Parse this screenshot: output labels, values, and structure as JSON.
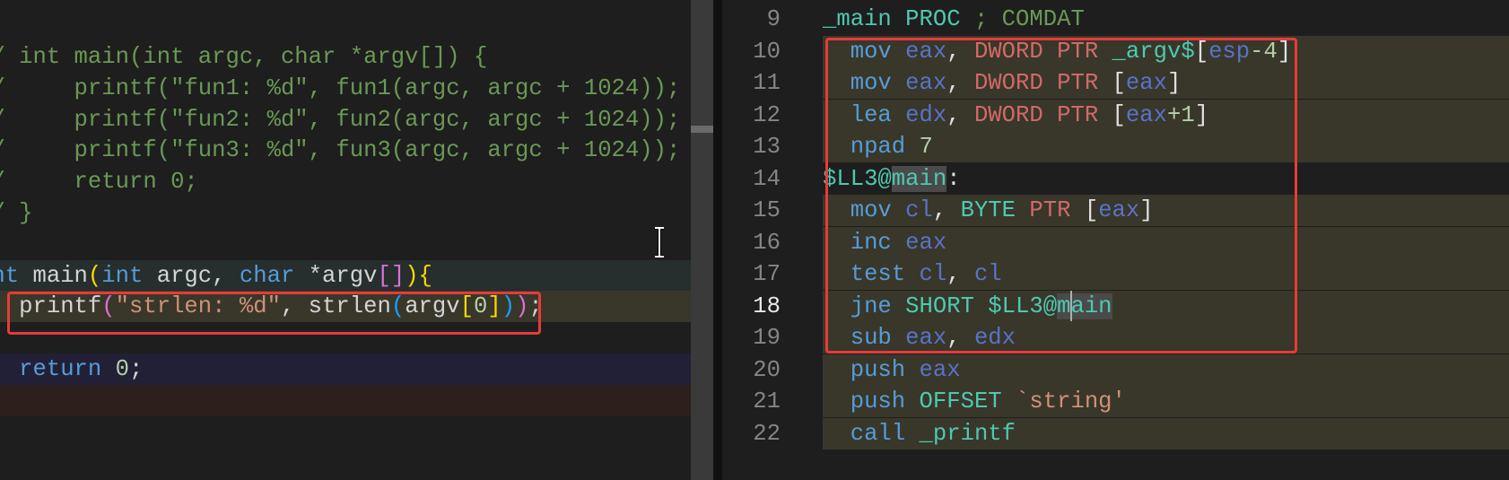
{
  "colors": {
    "highlight_box": "#e83a3a",
    "editor_bg": "#1e1e1e",
    "selection_bg": "#38372a"
  },
  "left_editor": {
    "lines": [
      {
        "bg": "",
        "tokens": [
          [
            "/ int main(int argc, char *argv[]) {",
            "comment"
          ]
        ]
      },
      {
        "bg": "",
        "tokens": [
          [
            "/     printf(\"fun1: %d\", fun1(argc, argc + 1024));",
            "comment"
          ]
        ]
      },
      {
        "bg": "",
        "tokens": [
          [
            "/     printf(\"fun2: %d\", fun2(argc, argc + 1024));",
            "comment"
          ]
        ]
      },
      {
        "bg": "",
        "tokens": [
          [
            "/     printf(\"fun3: %d\", fun3(argc, argc + 1024));",
            "comment"
          ]
        ]
      },
      {
        "bg": "",
        "tokens": [
          [
            "/     return 0;",
            "comment"
          ]
        ]
      },
      {
        "bg": "",
        "tokens": [
          [
            "/ }",
            "comment"
          ]
        ]
      },
      {
        "bg": "",
        "tokens": []
      },
      {
        "bg": "#262e2e",
        "tokens": [
          [
            "nt",
            "kw"
          ],
          [
            " main",
            "plain"
          ],
          [
            "(",
            "b-yellow"
          ],
          [
            "int",
            "kw"
          ],
          [
            " argc, ",
            "plain"
          ],
          [
            "char",
            "kw"
          ],
          [
            " *argv",
            "plain"
          ],
          [
            "[]",
            "b-pink"
          ],
          [
            ")",
            "b-yellow"
          ],
          [
            "{",
            "b-yellow"
          ]
        ]
      },
      {
        "bg": "#38372a",
        "tokens": [
          [
            "  printf",
            "plain"
          ],
          [
            "(",
            "b-pink"
          ],
          [
            "\"strlen: %d\"",
            "str"
          ],
          [
            ", strlen",
            "plain"
          ],
          [
            "(",
            "b-blue"
          ],
          [
            "argv",
            "plain"
          ],
          [
            "[",
            "b-yellow"
          ],
          [
            "0",
            "num"
          ],
          [
            "]",
            "b-yellow"
          ],
          [
            ")",
            "b-blue"
          ],
          [
            ")",
            "b-pink"
          ],
          [
            ";",
            "plain"
          ]
        ]
      },
      {
        "bg": "",
        "tokens": []
      },
      {
        "bg": "#222036",
        "tokens": [
          [
            "  return",
            "kw"
          ],
          [
            " ",
            "plain"
          ],
          [
            "0",
            "num"
          ],
          [
            ";",
            "plain"
          ]
        ]
      },
      {
        "bg": "#2d1f1c",
        "tokens": []
      },
      {
        "bg": "",
        "tokens": []
      }
    ]
  },
  "right_editor": {
    "active_line": "18",
    "lines": [
      {
        "num": "9",
        "bg": "",
        "tokens": [
          [
            "_main PROC",
            "sym"
          ],
          [
            " ; COMDAT",
            "comment"
          ]
        ]
      },
      {
        "num": "10",
        "bg": "#38372a",
        "tokens": [
          [
            "  mov",
            "op"
          ],
          [
            " eax",
            "reg"
          ],
          [
            ", ",
            "white"
          ],
          [
            "DWORD PTR",
            "ptr"
          ],
          [
            " _argv$",
            "sym"
          ],
          [
            "[",
            "white"
          ],
          [
            "esp",
            "reg"
          ],
          [
            "-4",
            "num"
          ],
          [
            "]",
            "white"
          ]
        ]
      },
      {
        "num": "11",
        "bg": "#38372a",
        "tokens": [
          [
            "  mov",
            "op"
          ],
          [
            " eax",
            "reg"
          ],
          [
            ", ",
            "white"
          ],
          [
            "DWORD PTR",
            "ptr"
          ],
          [
            " [",
            "white"
          ],
          [
            "eax",
            "reg"
          ],
          [
            "]",
            "white"
          ]
        ]
      },
      {
        "num": "12",
        "bg": "#38372a",
        "tokens": [
          [
            "  lea",
            "op"
          ],
          [
            " edx",
            "reg"
          ],
          [
            ", ",
            "white"
          ],
          [
            "DWORD PTR",
            "ptr"
          ],
          [
            " [",
            "white"
          ],
          [
            "eax",
            "reg"
          ],
          [
            "+1",
            "num"
          ],
          [
            "]",
            "white"
          ]
        ]
      },
      {
        "num": "13",
        "bg": "#38372a",
        "tokens": [
          [
            "  npad",
            "op"
          ],
          [
            " 7",
            "num"
          ]
        ]
      },
      {
        "num": "14",
        "bg": "",
        "tokens": [
          [
            "$LL3@",
            "sym"
          ],
          [
            "main",
            "sym hl"
          ],
          [
            ":",
            "white"
          ]
        ]
      },
      {
        "num": "15",
        "bg": "#38372a",
        "tokens": [
          [
            "  mov",
            "op"
          ],
          [
            " cl",
            "reg"
          ],
          [
            ", ",
            "white"
          ],
          [
            "BYTE",
            "sym"
          ],
          [
            " PTR",
            "ptr"
          ],
          [
            " [",
            "white"
          ],
          [
            "eax",
            "reg"
          ],
          [
            "]",
            "white"
          ]
        ]
      },
      {
        "num": "16",
        "bg": "#38372a",
        "tokens": [
          [
            "  inc",
            "op"
          ],
          [
            " eax",
            "reg"
          ]
        ]
      },
      {
        "num": "17",
        "bg": "#38372a",
        "tokens": [
          [
            "  test",
            "op"
          ],
          [
            " cl",
            "reg"
          ],
          [
            ", ",
            "white"
          ],
          [
            "cl",
            "reg"
          ]
        ]
      },
      {
        "num": "18",
        "bg": "#38372a",
        "tokens": [
          [
            "  jne",
            "op"
          ],
          [
            " SHORT $LL3@",
            "sym"
          ],
          [
            "main",
            "sym hl"
          ]
        ]
      },
      {
        "num": "19",
        "bg": "#38372a",
        "tokens": [
          [
            "  sub",
            "op"
          ],
          [
            " eax",
            "reg"
          ],
          [
            ", ",
            "white"
          ],
          [
            "edx",
            "reg"
          ]
        ]
      },
      {
        "num": "20",
        "bg": "#38372a",
        "tokens": [
          [
            "  push",
            "op"
          ],
          [
            " eax",
            "reg"
          ]
        ]
      },
      {
        "num": "21",
        "bg": "#38372a",
        "tokens": [
          [
            "  push",
            "op"
          ],
          [
            " OFFSET",
            "sym"
          ],
          [
            " `string'",
            "str"
          ]
        ]
      },
      {
        "num": "22",
        "bg": "#38372a",
        "tokens": [
          [
            "  call",
            "op"
          ],
          [
            " _printf",
            "sym"
          ]
        ]
      }
    ]
  }
}
